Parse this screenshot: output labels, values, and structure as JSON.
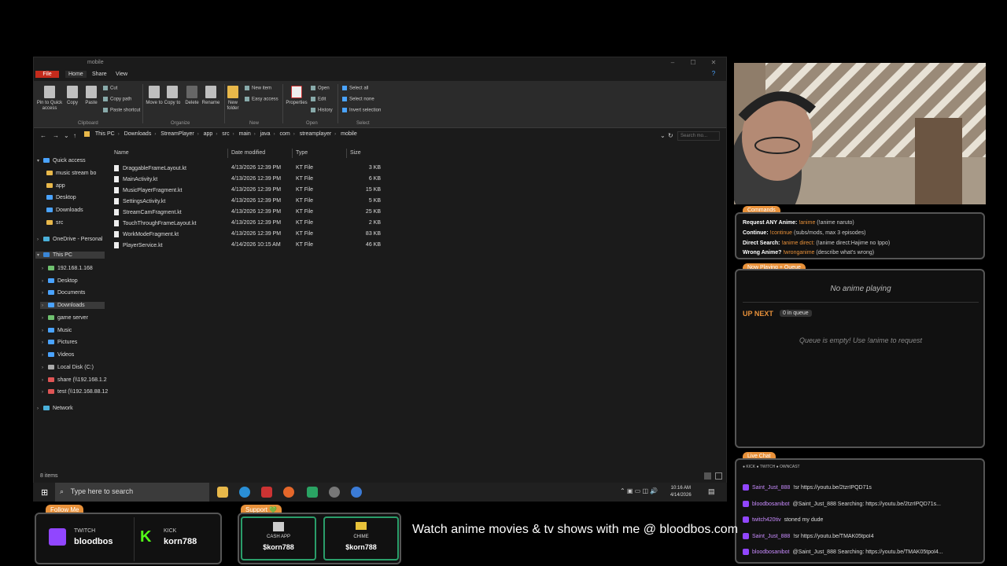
{
  "explorer": {
    "title": "mobile",
    "tabs": [
      "File",
      "Home",
      "Share",
      "View"
    ],
    "ribbon": {
      "pin": "Pin to Quick access",
      "copy": "Copy",
      "paste": "Paste",
      "cut": "Cut",
      "copy_path": "Copy path",
      "paste_shortcut": "Paste shortcut",
      "move_to": "Move to",
      "copy_to": "Copy to",
      "delete": "Delete",
      "rename": "Rename",
      "new_folder": "New folder",
      "new_item": "New item",
      "easy_access": "Easy access",
      "properties": "Properties",
      "open": "Open",
      "edit": "Edit",
      "history": "History",
      "select_all": "Select all",
      "select_none": "Select none",
      "invert_selection": "Invert selection",
      "groups": [
        "Clipboard",
        "Organize",
        "New",
        "Open",
        "Select"
      ]
    },
    "breadcrumbs": [
      "This PC",
      "Downloads",
      "StreamPlayer",
      "app",
      "src",
      "main",
      "java",
      "com",
      "streamplayer",
      "mobile"
    ],
    "search_placeholder": "Search mo...",
    "nav": {
      "quick_access": "Quick access",
      "quick_items": [
        "music stream bo",
        "app",
        "Desktop",
        "Downloads",
        "src"
      ],
      "onedrive": "OneDrive - Personal",
      "this_pc": "This PC",
      "pc_items": [
        "192.168.1.168",
        "Desktop",
        "Documents",
        "Downloads",
        "game server",
        "Music",
        "Pictures",
        "Videos",
        "Local Disk (C:)",
        "share (\\\\192.168.1.2",
        "test (\\\\192.168.88.12"
      ],
      "network": "Network"
    },
    "columns": [
      "Name",
      "Date modified",
      "Type",
      "Size"
    ],
    "files": [
      {
        "name": "DraggableFrameLayout.kt",
        "date": "4/13/2026 12:39 PM",
        "type": "KT File",
        "size": "3 KB"
      },
      {
        "name": "MainActivity.kt",
        "date": "4/13/2026 12:39 PM",
        "type": "KT File",
        "size": "6 KB"
      },
      {
        "name": "MusicPlayerFragment.kt",
        "date": "4/13/2026 12:39 PM",
        "type": "KT File",
        "size": "15 KB"
      },
      {
        "name": "SettingsActivity.kt",
        "date": "4/13/2026 12:39 PM",
        "type": "KT File",
        "size": "5 KB"
      },
      {
        "name": "StreamCamFragment.kt",
        "date": "4/13/2026 12:39 PM",
        "type": "KT File",
        "size": "25 KB"
      },
      {
        "name": "TouchThroughFrameLayout.kt",
        "date": "4/13/2026 12:39 PM",
        "type": "KT File",
        "size": "2 KB"
      },
      {
        "name": "WorkModeFragment.kt",
        "date": "4/13/2026 12:39 PM",
        "type": "KT File",
        "size": "83 KB"
      },
      {
        "name": "PlayerService.kt",
        "date": "4/14/2026 10:15 AM",
        "type": "KT File",
        "size": "46 KB"
      }
    ],
    "status": "8 items"
  },
  "taskbar": {
    "search_placeholder": "Type here to search",
    "time": "10:16 AM",
    "date": "4/14/2026"
  },
  "stream": {
    "commands_tag": "Commands",
    "commands": [
      {
        "label": "Request ANY Anime:",
        "cmd": "!anime",
        "desc": "(!anime naruto)"
      },
      {
        "label": "Continue:",
        "cmd": "!continue",
        "desc": "(subs/mods, max 3 episodes)"
      },
      {
        "label": "Direct Search:",
        "cmd": "!anime direct:",
        "desc": "(!anime direct:Hajime no Ippo)"
      },
      {
        "label": "Wrong Anime?",
        "cmd": "!wronganime",
        "desc": "(describe what's wrong)"
      }
    ],
    "now_playing_tag": "Now Playing + Queue",
    "no_anime": "No anime playing",
    "up_next": "UP NEXT",
    "queue_count": "0 in queue",
    "queue_empty": "Queue is empty! Use !anime to request",
    "live_chat_tag": "Live Chat",
    "chat_platforms": "● KICK  ● TWITCH  ● OWNCAST",
    "chat": [
      {
        "user": "Saint_Just_888",
        "msg": "!sr https://youtu.be/2tzrIPQD71s"
      },
      {
        "user": "bloodbosanibot",
        "msg": "@Saint_Just_888 Searching: https://youtu.be/2tzrIPQD71s..."
      },
      {
        "user": "twitch420tiv",
        "msg": "stoned my dude"
      },
      {
        "user": "Saint_Just_888",
        "msg": "!sr https://youtu.be/TMAK05tpoI4"
      },
      {
        "user": "bloodbosanibot",
        "msg": "@Saint_Just_888 Searching: https://youtu.be/TMAK05tpoI4..."
      }
    ],
    "follow_tag": "Follow Me",
    "twitch_label": "TWITCH",
    "twitch_user": "bloodbos",
    "kick_label": "KICK",
    "kick_user": "korn788",
    "support_tag": "Support 💚",
    "cashapp_label": "CASH APP",
    "cashapp_user": "$korn788",
    "chime_label": "CHIME",
    "chime_user": "$korn788",
    "watch_text": "Watch anime movies & tv shows with me @ bloodbos.com"
  }
}
